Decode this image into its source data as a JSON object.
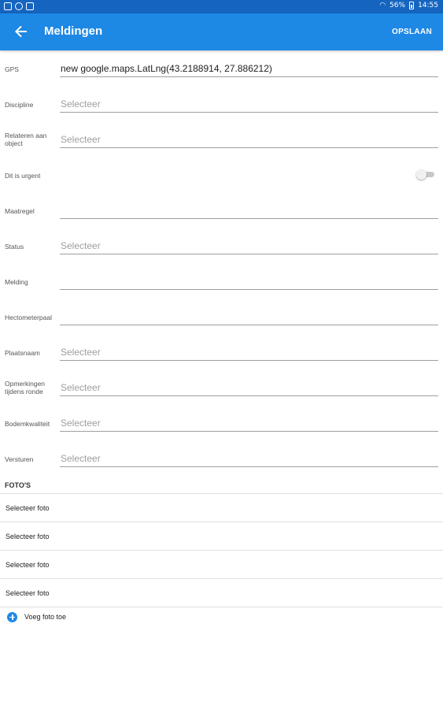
{
  "statusbar": {
    "battery": "56%",
    "time": "14:55"
  },
  "appbar": {
    "title": "Meldingen",
    "save_label": "OPSLAAN"
  },
  "form": {
    "fields": [
      {
        "label": "GPS",
        "value": "new google.maps.LatLng(43.2188914, 27.886212)"
      },
      {
        "label": "Discipline",
        "placeholder": "Selecteer"
      },
      {
        "label": "Relateren aan object",
        "placeholder": "Selecteer"
      },
      {
        "label": "Dit is urgent",
        "toggle_on": false
      },
      {
        "label": "Maatregel",
        "value": ""
      },
      {
        "label": "Status",
        "placeholder": "Selecteer"
      },
      {
        "label": "Melding",
        "value": ""
      },
      {
        "label": "Hectometerpaal",
        "value": ""
      },
      {
        "label": "Plaatsnaam",
        "placeholder": "Selecteer"
      },
      {
        "label": "Opmerkingen tijdens ronde",
        "placeholder": "Selecteer"
      },
      {
        "label": "Bodemkwaliteit",
        "placeholder": "Selecteer"
      },
      {
        "label": "Versturen",
        "placeholder": "Selecteer"
      }
    ]
  },
  "fotos": {
    "header": "FOTO'S",
    "items": [
      "Selecteer foto",
      "Selecteer foto",
      "Selecteer foto",
      "Selecteer foto"
    ],
    "add_label": "Voeg foto toe"
  },
  "colors": {
    "appbar": "#1e88e5",
    "statusbar": "#1565c0"
  }
}
